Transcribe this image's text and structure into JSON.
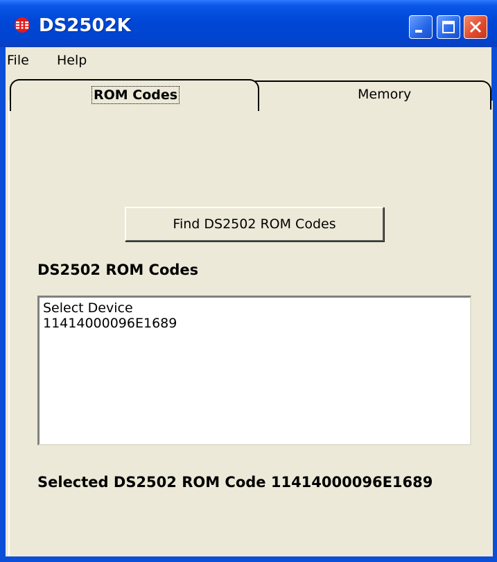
{
  "window": {
    "title": "DS2502K",
    "colors": {
      "titlebar": "#0047d6",
      "client": "#ece9d8",
      "close": "#e0482a"
    }
  },
  "menubar": {
    "items": [
      "File",
      "Help"
    ]
  },
  "tabs": [
    {
      "label": "ROM Codes",
      "active": true
    },
    {
      "label": "Memory",
      "active": false
    }
  ],
  "rom_tab": {
    "find_button_label": "Find DS2502 ROM Codes",
    "list_heading": "DS2502 ROM Codes",
    "list_items": [
      "Select Device",
      "11414000096E1689"
    ],
    "selected_text": "Selected DS2502 ROM Code 11414000096E1689"
  },
  "icons": {
    "app": "maxim-logo-icon",
    "minimize": "minimize-icon",
    "maximize": "maximize-icon",
    "close": "close-icon"
  }
}
